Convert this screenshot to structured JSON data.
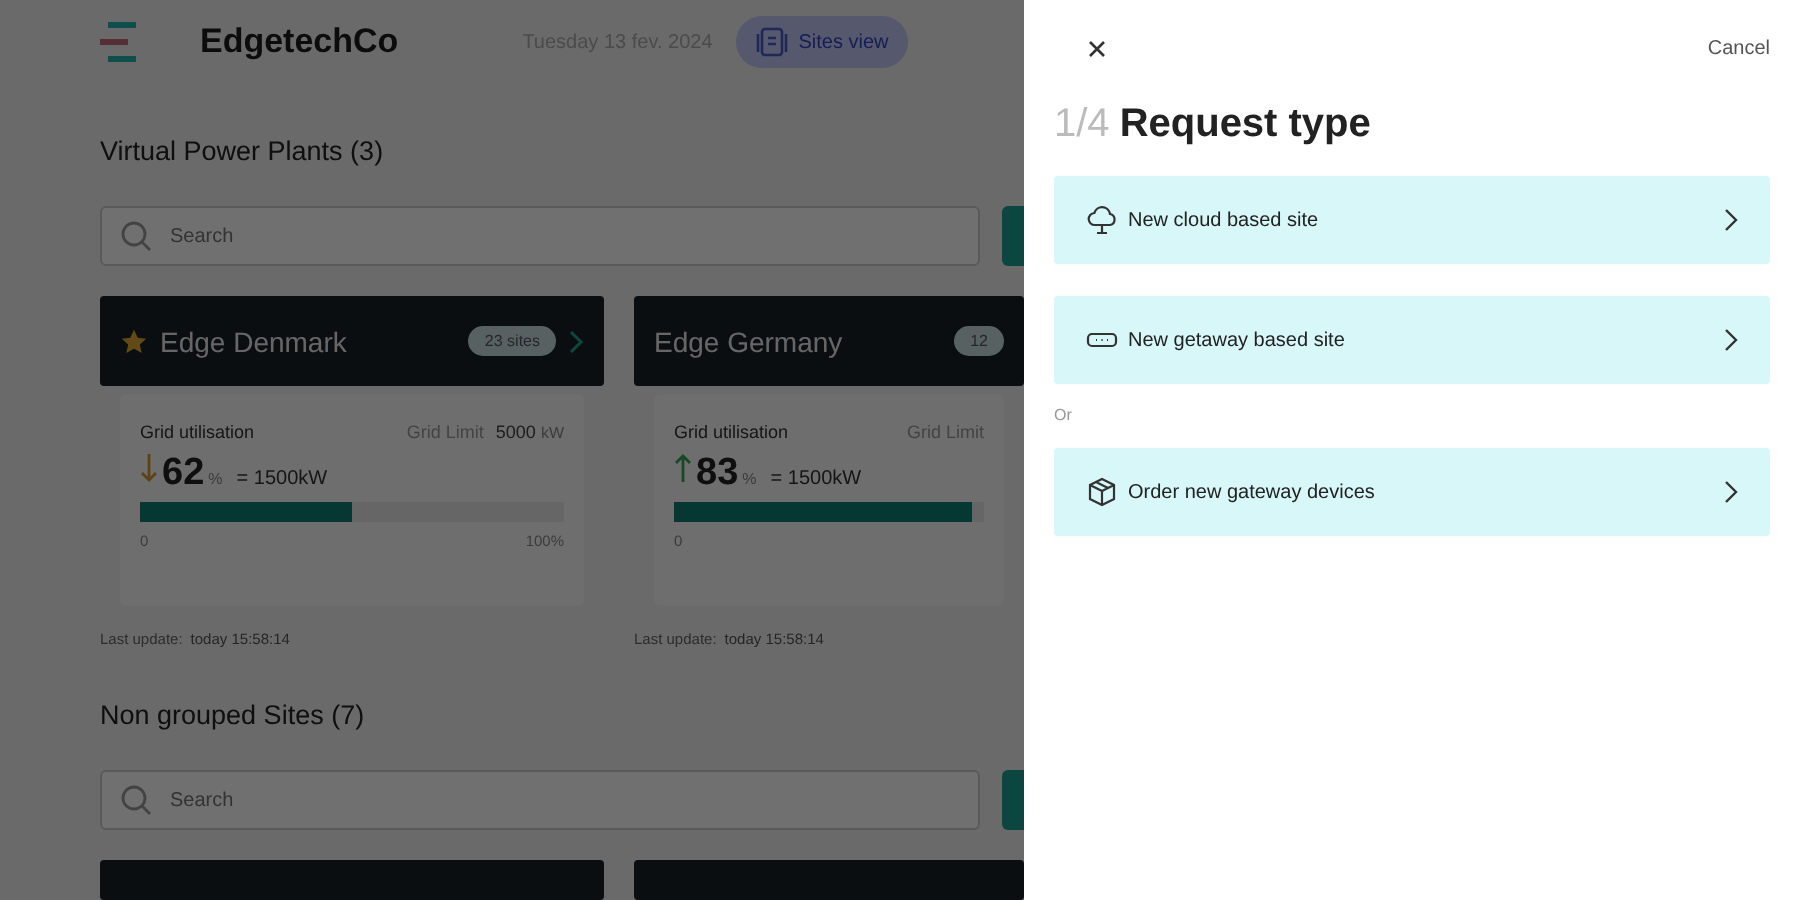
{
  "header": {
    "brand": "EdgetechCo",
    "date": "Tuesday 13 fev. 2024",
    "view_button": {
      "label": "Sites view",
      "selected": true
    }
  },
  "sections": [
    {
      "title": "Virtual Power Plants (3)",
      "search_placeholder": "Search",
      "cards": [
        {
          "kind": "full",
          "name": "Edge Denmark",
          "favorite": true,
          "badge": "23 sites",
          "metric_label": "Grid utilisation",
          "limit_label": "Grid Limit",
          "limit_value": "5000",
          "limit_unit": "kW",
          "trend_up": false,
          "percent": "62",
          "percent_unit": "%",
          "equivalent": "= 1500kW",
          "level": 0.5,
          "scale_min": "0",
          "scale_max": "100%",
          "update_label": "Last update:",
          "update_value": "today 15:58:14"
        },
        {
          "kind": "full",
          "name": "Edge Germany",
          "favorite": false,
          "badge": "12",
          "metric_label": "Grid utilisation",
          "limit_label": "Grid Limit",
          "trend_up": true,
          "percent": "83",
          "percent_unit": "%",
          "equivalent": "= 1500kW",
          "level": 0.96,
          "scale_min": "0",
          "update_label": "Last update:",
          "update_value": "today 15:58:14"
        }
      ]
    },
    {
      "title": "Non grouped Sites (7)",
      "search_placeholder": "Search",
      "cards": [
        {
          "kind": "stub"
        },
        {
          "kind": "stub"
        }
      ]
    }
  ],
  "panel": {
    "cancel": "Cancel",
    "step": "1/4",
    "title": "Request type",
    "items": [
      {
        "kind": "option",
        "label": "New cloud based site"
      },
      {
        "kind": "option",
        "label": "New getaway based site"
      },
      {
        "kind": "separator",
        "label": "Or"
      },
      {
        "kind": "option",
        "label": "Order new gateway devices"
      }
    ]
  }
}
